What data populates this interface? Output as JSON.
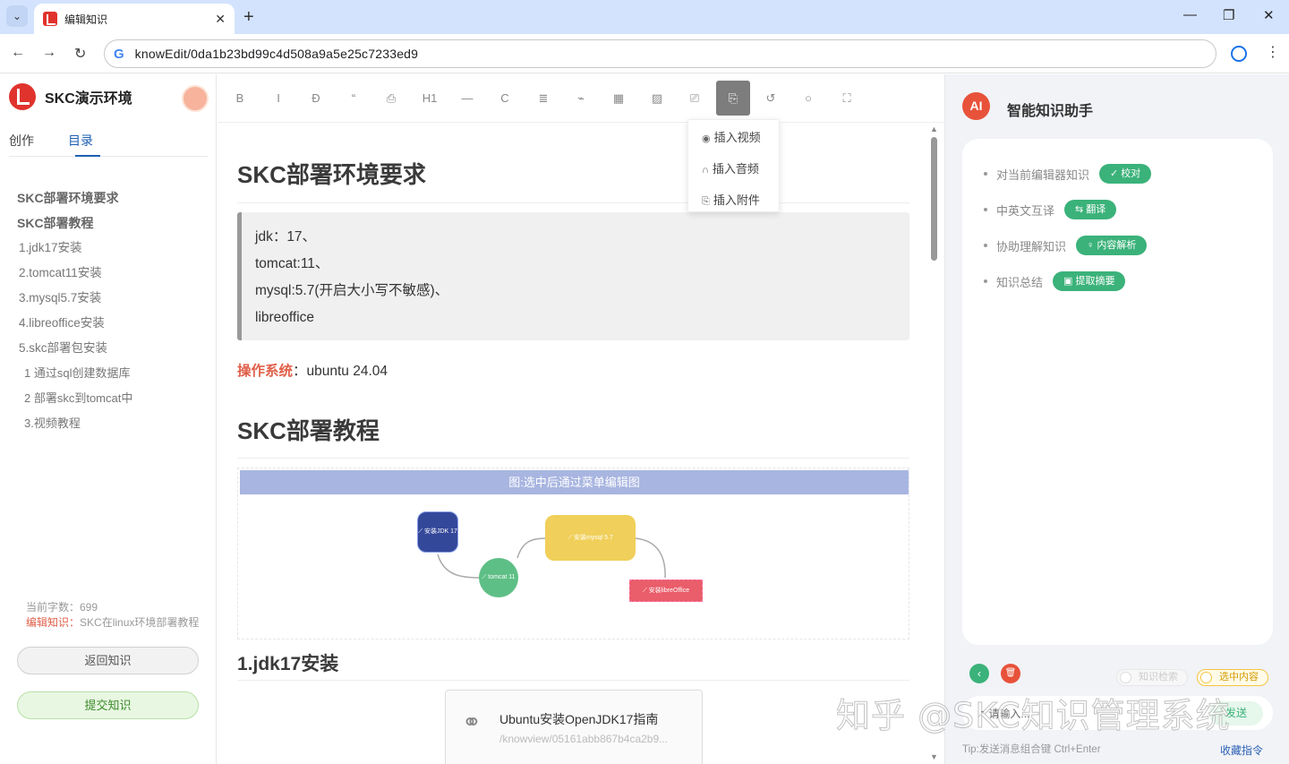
{
  "browser": {
    "tab_title": "编辑知识",
    "tab_close": "✕",
    "new_tab": "+",
    "url": "knowEdit/0da1b23bd99c4d508a9a5e25c7233ed9",
    "win_min": "—",
    "win_max": "❐",
    "win_close": "✕",
    "back": "←",
    "forward": "→",
    "reload": "↻",
    "google": "G",
    "menu": "⋮"
  },
  "sidebar": {
    "brand": "SKC演示环境",
    "tabs": [
      "创作",
      "目录"
    ],
    "active_tab": "目录",
    "toc": [
      {
        "text": "SKC部署环境要求",
        "level": 1
      },
      {
        "text": "SKC部署教程",
        "level": 1
      },
      {
        "text": "1.jdk17安装",
        "level": 2
      },
      {
        "text": "2.tomcat11安装",
        "level": 2
      },
      {
        "text": "3.mysql5.7安装",
        "level": 2
      },
      {
        "text": "4.libreoffice安装",
        "level": 2
      },
      {
        "text": "5.skc部署包安装",
        "level": 2
      },
      {
        "text": "1 通过sql创建数据库",
        "level": 3
      },
      {
        "text": "2 部署skc到tomcat中",
        "level": 3
      },
      {
        "text": "3.视频教程",
        "level": 3
      }
    ],
    "word_count": "当前字数：699",
    "editing_label": "编辑知识：",
    "editing_value": "SKC在linux环境部署教程",
    "back_button": "返回知识",
    "submit_button": "提交知识"
  },
  "toolbar": {
    "buttons": [
      {
        "name": "bold-button",
        "glyph": "B"
      },
      {
        "name": "italic-button",
        "glyph": "I"
      },
      {
        "name": "strikethrough-button",
        "glyph": "Ð"
      },
      {
        "name": "quote-button",
        "glyph": "“"
      },
      {
        "name": "code-block-button",
        "glyph": "⎙"
      },
      {
        "name": "heading-button",
        "glyph": "H1"
      },
      {
        "name": "divider-button",
        "glyph": "—"
      },
      {
        "name": "code-button",
        "glyph": "C"
      },
      {
        "name": "list-button",
        "glyph": "≣"
      },
      {
        "name": "link-button",
        "glyph": "⌁"
      },
      {
        "name": "table-button",
        "glyph": "▦"
      },
      {
        "name": "image-button",
        "glyph": "▨"
      },
      {
        "name": "flowchart-button",
        "glyph": "⎚"
      },
      {
        "name": "attachment-button",
        "glyph": "⎘"
      },
      {
        "name": "undo-button",
        "glyph": "↺"
      },
      {
        "name": "search-button",
        "glyph": "○"
      },
      {
        "name": "fullscreen-button",
        "glyph": "⛶"
      }
    ],
    "dropdown": [
      {
        "icon": "◉",
        "label": "插入视频"
      },
      {
        "icon": "∩",
        "label": "插入音频"
      },
      {
        "icon": "⎘",
        "label": "插入附件"
      }
    ]
  },
  "doc": {
    "h1": "SKC部署环境要求",
    "quote_lines": [
      "jdk：17、",
      "tomcat:11、",
      "mysql:5.7(开启大小写不敏感)、",
      "libreoffice"
    ],
    "os_label": "操作系统",
    "os_value": "：ubuntu 24.04",
    "h2": "SKC部署教程",
    "flow_title": "图:选中后通过菜单编辑图",
    "flow_nodes": {
      "jdk": "⟋ 安装JDK 17",
      "tomcat": "⟋ tomcat 11",
      "mysql": "⟋ 安装mysql 5.7",
      "libre": "⟋ 安装libreOffice"
    },
    "h3": "1.jdk17安装",
    "link_title": "Ubuntu安装OpenJDK17指南",
    "link_url": "/knowview/05161abb867b4ca2b9..."
  },
  "assistant": {
    "badge": "AI",
    "title": "智能知识助手",
    "items": [
      {
        "text": "对当前编辑器知识",
        "action": "✓ 校对"
      },
      {
        "text": "中英文互译",
        "action": "⇆ 翻译"
      },
      {
        "text": "协助理解知识",
        "action": "♀ 内容解析"
      },
      {
        "text": "知识总结",
        "action": "▣ 提取摘要"
      }
    ],
    "back_icon": "‹",
    "delete_icon": "🗑",
    "toggle_search": "知识检索",
    "toggle_selected": "选中内容",
    "input_placeholder": "↗ 请输入...",
    "send": "发送",
    "tip": "Tip:发送消息组合键 Ctrl+Enter",
    "favorites": "收藏指令"
  },
  "watermark": "知乎 @SKC知识管理系统",
  "colors": {
    "brand_red": "#e0332d",
    "accent_green": "#3bb27a",
    "link_blue": "#1e5fb3",
    "node_jdk": "#34489a",
    "node_tomcat": "#5ebf86",
    "node_mysql": "#f0cf5a",
    "node_libre": "#ea5d6a"
  }
}
